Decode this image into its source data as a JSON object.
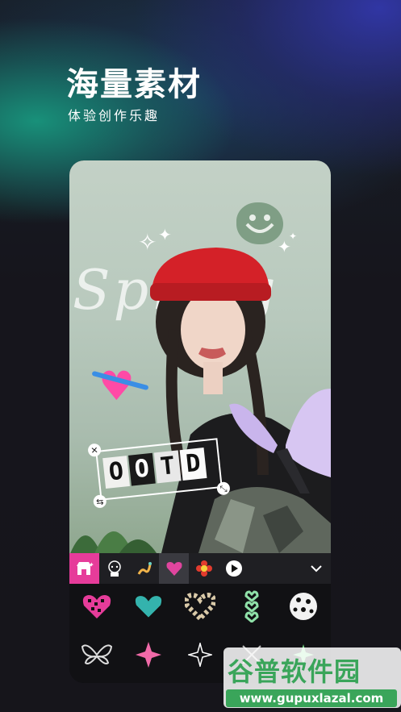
{
  "hero": {
    "title": "海量素材",
    "subtitle": "体验创作乐趣"
  },
  "photo": {
    "script_word": "Spring",
    "ootd_letters": [
      "O",
      "O",
      "T",
      "D"
    ]
  },
  "toolbar": {
    "items": [
      "store-icon",
      "doll-sticker-icon",
      "worm-sticker-icon",
      "checker-heart-icon",
      "flower-icon",
      "play-icon"
    ],
    "active": "checker-heart-icon",
    "expand": "chevron-down-icon"
  },
  "stickers": {
    "row1": [
      "pixel-heart-sticker",
      "teal-heart-sticker",
      "zebra-heart-sticker",
      "chain-hearts-sticker",
      "leopard-flower-sticker"
    ],
    "row2": [
      "butterfly-sticker",
      "pink-star-sticker",
      "white-sparkle-sticker",
      "cross-sparkle-sticker",
      "green-star-sticker"
    ]
  },
  "watermark": {
    "name": "谷普软件园",
    "url": "www.gupuxlazal.com"
  },
  "colors": {
    "accent": "#e63c9a",
    "hat": "#d42128",
    "heart": "#ff4aa6",
    "butterfly": "#c9b5ec",
    "smiley": "#7f9e85"
  }
}
